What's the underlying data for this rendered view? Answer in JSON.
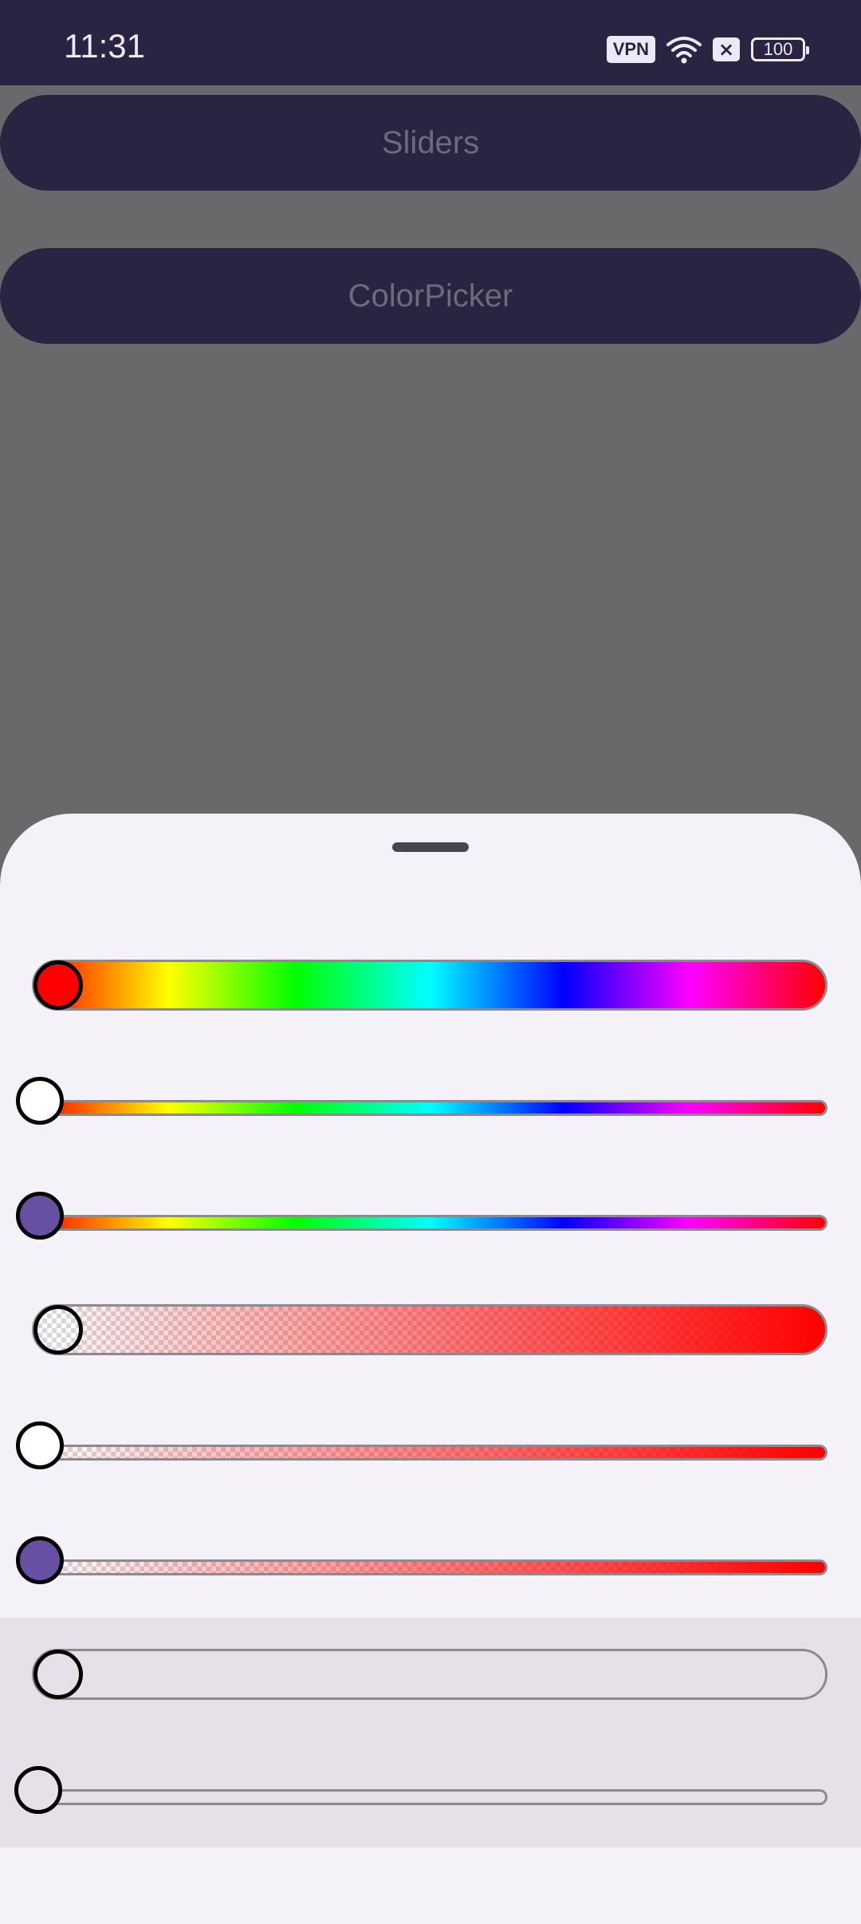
{
  "status_bar": {
    "time": "11:31",
    "vpn_label": "VPN",
    "battery_level": "100",
    "icons": [
      "vpn-icon",
      "wifi-icon",
      "notification-blocked-icon",
      "battery-icon"
    ]
  },
  "buttons": {
    "sliders_label": "Sliders",
    "colorpicker_label": "ColorPicker"
  },
  "sheet": {
    "sliders": [
      {
        "kind": "hue",
        "style": "thick",
        "value": 0,
        "thumb_color": "#ff0000"
      },
      {
        "kind": "hue",
        "style": "thin",
        "value": 0,
        "thumb_color": "#ffffff"
      },
      {
        "kind": "hue",
        "style": "thin",
        "value": 0,
        "thumb_color": "#6750a4"
      },
      {
        "kind": "alpha",
        "style": "thick",
        "value": 0,
        "thumb_color": "checkered"
      },
      {
        "kind": "alpha",
        "style": "thin",
        "value": 0,
        "thumb_color": "#ffffff"
      },
      {
        "kind": "alpha",
        "style": "thin",
        "value": 0,
        "thumb_color": "#6750a4"
      },
      {
        "kind": "disabled",
        "style": "thick",
        "value": 0,
        "thumb_color": "#e6e1e8"
      },
      {
        "kind": "disabled",
        "style": "thin",
        "value": 0,
        "thumb_color": "#e6e1e8"
      }
    ]
  },
  "colors": {
    "status_bar_bg": "#2b2342",
    "scrim": "#6a686b",
    "sheet_bg": "#f4f1f8",
    "accent": "#6750a4"
  }
}
